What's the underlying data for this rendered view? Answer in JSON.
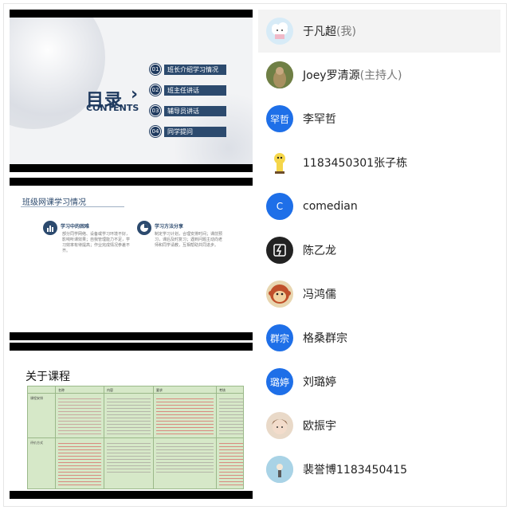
{
  "slides": {
    "toc": {
      "title": "目录",
      "chevron": "›",
      "subtitle": "CONTENTS",
      "items": [
        {
          "num": "01",
          "label": "班长介绍学习情况"
        },
        {
          "num": "02",
          "label": "班主任讲话"
        },
        {
          "num": "03",
          "label": "辅导员讲话"
        },
        {
          "num": "04",
          "label": "同学提问"
        }
      ]
    },
    "study": {
      "heading": "班级网课学习情况",
      "left_sub": "学习中的困难",
      "right_sub": "学习方法分享",
      "left_text": "部分同学网络、设备或学习环境不好，影响听课效果；自我管理能力不足，学习效率有待提高；作业完成情况参差不齐。",
      "right_text": "制定学习计划，合理安排时间；课前预习，课后及时复习；遇到问题主动向老师和同学请教，互相帮助共同进步。"
    },
    "course": {
      "title": "关于课程",
      "headers": [
        "名称",
        "内容",
        "要求",
        "考核"
      ],
      "row1_label": "课程安排",
      "row2_label": "评价方式"
    }
  },
  "participants": [
    {
      "name": "于凡超",
      "role": "(我)",
      "avatar_type": "image",
      "avatar_icon": "cloud-avatar-icon",
      "avatar_color": "#cfe6f5",
      "self": true
    },
    {
      "name": "Joey罗清源",
      "role": "(主持人)",
      "avatar_type": "image",
      "avatar_icon": "photo-avatar-icon",
      "avatar_color": "#8a7a55"
    },
    {
      "name": "李罕哲",
      "role": "",
      "avatar_type": "text",
      "avatar_text": "罕哲",
      "avatar_color": "#1e6fe8"
    },
    {
      "name": "1183450301张子栋",
      "role": "",
      "avatar_type": "image",
      "avatar_icon": "cartoon-avatar-icon",
      "avatar_color": "#f5d64a"
    },
    {
      "name": "comedian",
      "role": "",
      "avatar_type": "text",
      "avatar_text": "C",
      "avatar_color": "#1e6fe8"
    },
    {
      "name": "陈乙龙",
      "role": "",
      "avatar_type": "image",
      "avatar_icon": "logo-avatar-icon",
      "avatar_color": "#222222"
    },
    {
      "name": "冯鸿儒",
      "role": "",
      "avatar_type": "image",
      "avatar_icon": "monkey-avatar-icon",
      "avatar_color": "#c0502a"
    },
    {
      "name": "格桑群宗",
      "role": "",
      "avatar_type": "text",
      "avatar_text": "群宗",
      "avatar_color": "#1e6fe8"
    },
    {
      "name": "刘璐婷",
      "role": "",
      "avatar_type": "text",
      "avatar_text": "璐婷",
      "avatar_color": "#1e6fe8"
    },
    {
      "name": "欧振宇",
      "role": "",
      "avatar_type": "image",
      "avatar_icon": "anime-avatar-icon",
      "avatar_color": "#b88b6a"
    },
    {
      "name": "裴誉博1183450415",
      "role": "",
      "avatar_type": "image",
      "avatar_icon": "sky-avatar-icon",
      "avatar_color": "#9ccbe0"
    }
  ]
}
